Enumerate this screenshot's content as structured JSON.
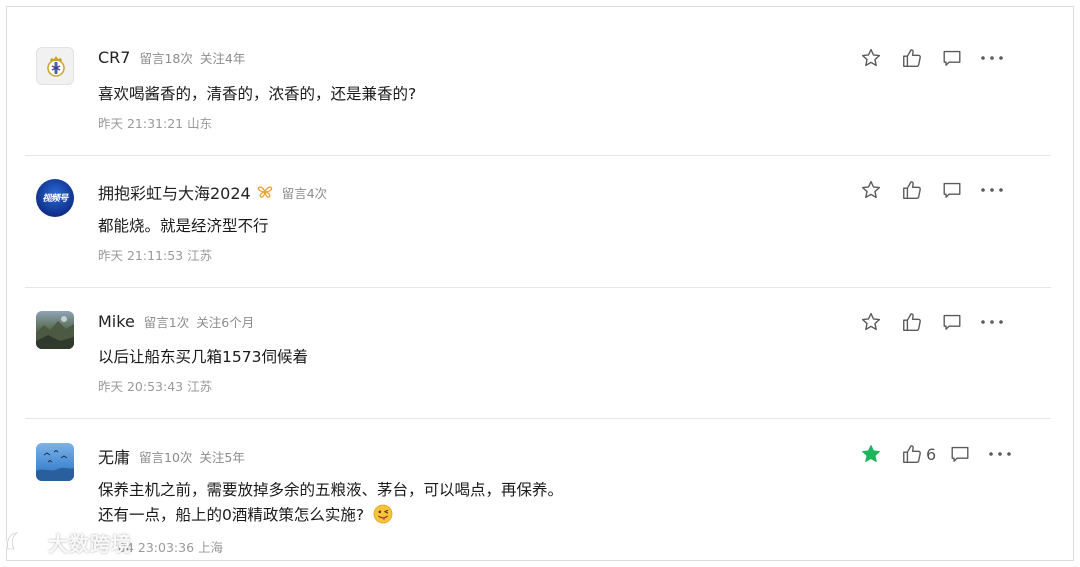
{
  "comments": [
    {
      "name": "CR7",
      "meta1": "留言18次",
      "meta2": "关注4年",
      "text_lines": [
        "喜欢喝酱香的，清香的，浓香的，还是兼香的?"
      ],
      "time": "昨天 21:31:21 山东",
      "avatar_icon": "real-madrid-crest-avatar",
      "starred": false,
      "like_count": ""
    },
    {
      "name": "拥抱彩虹与大海2024",
      "badge_icon": "butterfly-badge-icon",
      "meta1": "留言4次",
      "text_lines": [
        "都能烧。就是经济型不行"
      ],
      "time": "昨天 21:11:53 江苏",
      "avatar_icon": "blue-circle-avatar",
      "avatar_text": "视频号",
      "starred": false,
      "like_count": ""
    },
    {
      "name": "Mike",
      "meta1": "留言1次",
      "meta2": "关注6个月",
      "text_lines": [
        "以后让船东买几箱1573伺候着"
      ],
      "time": "昨天 20:53:43 江苏",
      "avatar_icon": "landscape-photo-avatar",
      "starred": false,
      "like_count": ""
    },
    {
      "name": "无庸",
      "meta1": "留言10次",
      "meta2": "关注5年",
      "text_lines": [
        "保养主机之前，需要放掉多余的五粮液、茅台，可以喝点，再保养。",
        "还有一点，船上的0酒精政策怎么实施?"
      ],
      "emoji": "tongue-wink-emoji",
      "time": "04 23:03:36 上海",
      "avatar_icon": "sky-birds-photo-avatar",
      "starred": true,
      "like_count": "6"
    }
  ],
  "watermark": {
    "text": "大数跨境"
  },
  "colors": {
    "star_active": "#1bb55c",
    "icon_gray": "#5a5a5a"
  }
}
